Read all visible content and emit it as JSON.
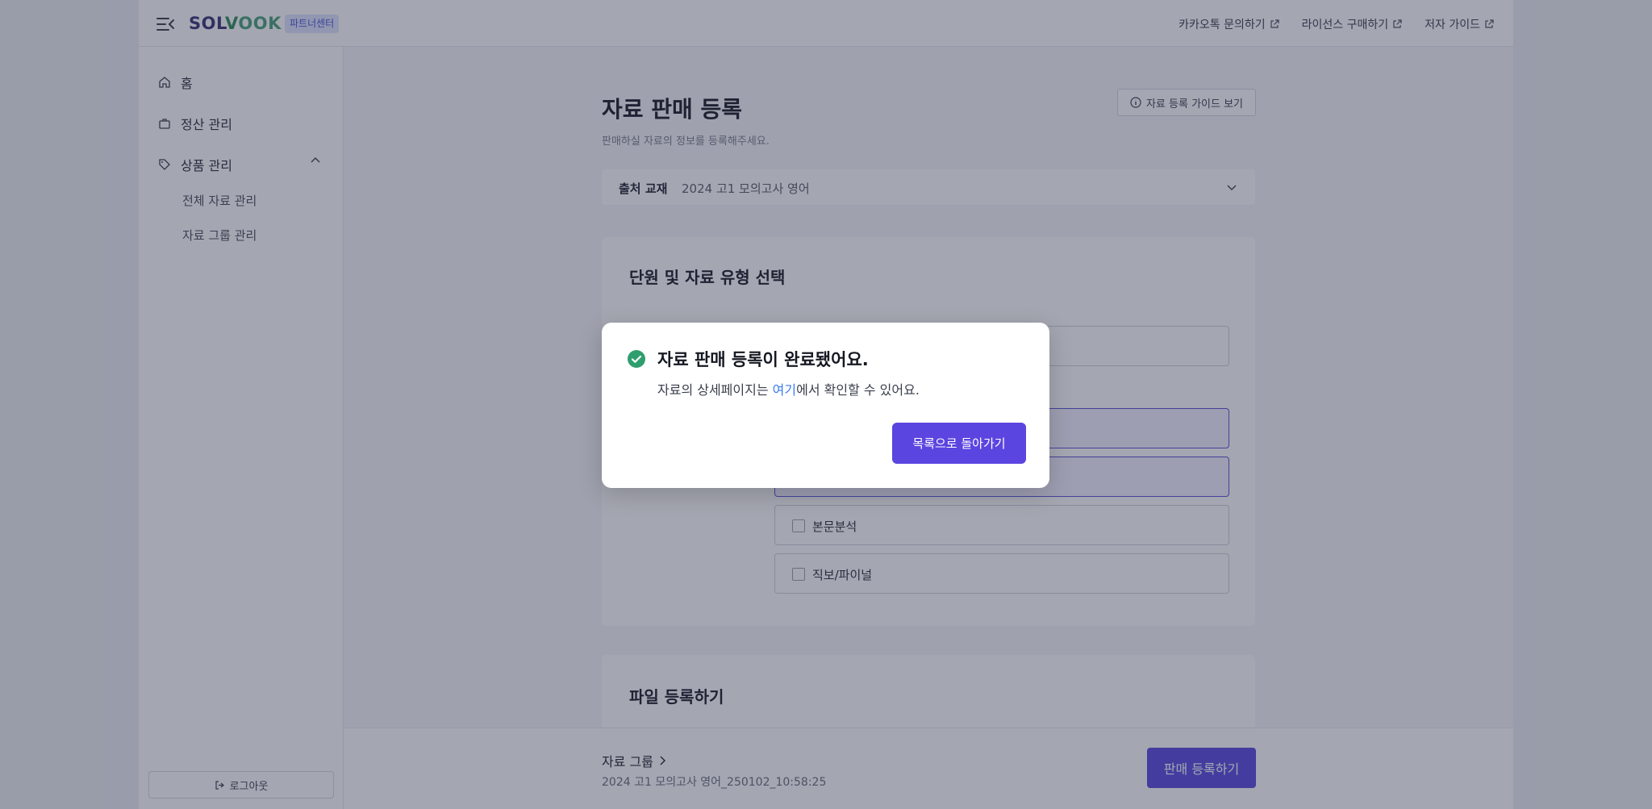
{
  "header": {
    "logo_sol": "SOL",
    "logo_v": "V",
    "logo_ook": "OOK",
    "partner_badge": "파트너센터",
    "links": [
      {
        "label": "카카오톡 문의하기"
      },
      {
        "label": "라이선스 구매하기"
      },
      {
        "label": "저자 가이드"
      }
    ]
  },
  "sidebar": {
    "items": [
      {
        "label": "홈"
      },
      {
        "label": "정산 관리"
      },
      {
        "label": "상품 관리"
      }
    ],
    "sub_items": [
      {
        "label": "전체 자료 관리"
      },
      {
        "label": "자료 그룹 관리"
      }
    ],
    "logout_label": "로그아웃"
  },
  "main": {
    "title": "자료 판매 등록",
    "subtitle": "판매하실 자료의 정보를 등록해주세요.",
    "guide_button": "자료 등록 가이드 보기",
    "source": {
      "label": "출처 교재",
      "value": "2024 고1 모의고사 영어"
    },
    "section1_title": "단원 및 자료 유형 선택",
    "type_options": [
      {
        "label": "본문분석",
        "checked": false
      },
      {
        "label": "직보/파이널",
        "checked": false
      }
    ],
    "section2_title": "파일 등록하기"
  },
  "bottom": {
    "group_label": "자료 그룹",
    "group_name": "2024 고1 모의고사 영어_250102_10:58:25",
    "register_button": "판매 등록하기"
  },
  "modal": {
    "title": "자료 판매 등록이 완료됐어요.",
    "body_prefix": "자료의 상세페이지는 ",
    "body_link": "여기",
    "body_suffix": "에서 확인할 수 있어요.",
    "button": "목록으로 돌아가기"
  },
  "colors": {
    "accent": "#5b45e0",
    "success": "#2f9e6e",
    "link": "#3a7bf0",
    "overlay": "rgba(38,44,70,0.42)"
  }
}
